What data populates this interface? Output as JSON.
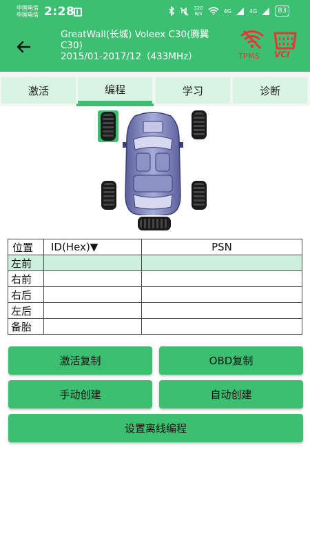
{
  "status_bar": {
    "carrier_1": "中国电信",
    "carrier_2": "中国电信",
    "time": "2:28",
    "net_speed_value": "320",
    "net_speed_unit": "B/s",
    "signal_1": "4G",
    "signal_2": "4G",
    "battery": "83"
  },
  "header": {
    "title_line1": "GreatWall(长城) Voleex C30(腾翼",
    "title_line2": "C30)",
    "title_line3": "2015/01-2017/12（433MHz）",
    "tpms_label": "TPMS",
    "vci_label": "VCI"
  },
  "tabs": [
    {
      "label": "激活"
    },
    {
      "label": "编程"
    },
    {
      "label": "学习"
    },
    {
      "label": "诊断"
    }
  ],
  "active_tab": "编程",
  "table": {
    "headers": {
      "position": "位置",
      "id": "ID(Hex)▼",
      "psn": "PSN"
    },
    "rows": [
      {
        "position": "左前",
        "id": "",
        "psn": ""
      },
      {
        "position": "右前",
        "id": "",
        "psn": ""
      },
      {
        "position": "右后",
        "id": "",
        "psn": ""
      },
      {
        "position": "左后",
        "id": "",
        "psn": ""
      },
      {
        "position": "备胎",
        "id": "",
        "psn": ""
      }
    ],
    "selected_row": "左前"
  },
  "buttons": {
    "activate_copy": "激活复制",
    "obd_copy": "OBD复制",
    "manual_create": "手动创建",
    "auto_create": "自动创建",
    "offline_program": "设置离线编程"
  },
  "colors": {
    "primary": "#3dbf72",
    "tab_bg": "#d8f4e3",
    "selected_row": "#cdf0dc",
    "logo_red": "#e33333"
  }
}
